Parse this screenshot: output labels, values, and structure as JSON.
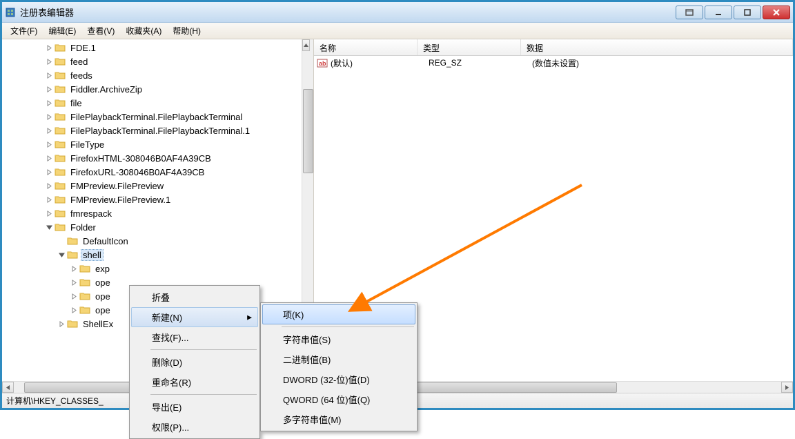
{
  "window": {
    "title": "注册表编辑器"
  },
  "menubar": {
    "items": [
      "文件(F)",
      "编辑(E)",
      "查看(V)",
      "收藏夹(A)",
      "帮助(H)"
    ]
  },
  "tree": {
    "items": [
      {
        "label": "FDE.1",
        "depth": 3,
        "expander": "closed",
        "expanded": false
      },
      {
        "label": "feed",
        "depth": 3,
        "expander": "closed",
        "expanded": false
      },
      {
        "label": "feeds",
        "depth": 3,
        "expander": "closed",
        "expanded": false
      },
      {
        "label": "Fiddler.ArchiveZip",
        "depth": 3,
        "expander": "closed",
        "expanded": false
      },
      {
        "label": "file",
        "depth": 3,
        "expander": "closed",
        "expanded": false
      },
      {
        "label": "FilePlaybackTerminal.FilePlaybackTerminal",
        "depth": 3,
        "expander": "closed",
        "expanded": false
      },
      {
        "label": "FilePlaybackTerminal.FilePlaybackTerminal.1",
        "depth": 3,
        "expander": "closed",
        "expanded": false
      },
      {
        "label": "FileType",
        "depth": 3,
        "expander": "closed",
        "expanded": false
      },
      {
        "label": "FirefoxHTML-308046B0AF4A39CB",
        "depth": 3,
        "expander": "closed",
        "expanded": false
      },
      {
        "label": "FirefoxURL-308046B0AF4A39CB",
        "depth": 3,
        "expander": "closed",
        "expanded": false
      },
      {
        "label": "FMPreview.FilePreview",
        "depth": 3,
        "expander": "closed",
        "expanded": false
      },
      {
        "label": "FMPreview.FilePreview.1",
        "depth": 3,
        "expander": "closed",
        "expanded": false
      },
      {
        "label": "fmrespack",
        "depth": 3,
        "expander": "closed",
        "expanded": false
      },
      {
        "label": "Folder",
        "depth": 3,
        "expander": "open",
        "expanded": true
      },
      {
        "label": "DefaultIcon",
        "depth": 4,
        "expander": "none",
        "expanded": false
      },
      {
        "label": "shell",
        "depth": 4,
        "expander": "open",
        "expanded": true,
        "selected": true
      },
      {
        "label": "exp",
        "depth": 5,
        "expander": "closed",
        "expanded": false
      },
      {
        "label": "ope",
        "depth": 5,
        "expander": "closed",
        "expanded": false
      },
      {
        "label": "ope",
        "depth": 5,
        "expander": "closed",
        "expanded": false
      },
      {
        "label": "ope",
        "depth": 5,
        "expander": "closed",
        "expanded": false
      },
      {
        "label": "ShellEx",
        "depth": 4,
        "expander": "closed",
        "expanded": false
      }
    ]
  },
  "list": {
    "columns": {
      "name": "名称",
      "type": "类型",
      "data": "数据"
    },
    "rows": [
      {
        "name": "(默认)",
        "type": "REG_SZ",
        "data": "(数值未设置)"
      }
    ]
  },
  "statusbar": {
    "path": "计算机\\HKEY_CLASSES_"
  },
  "context_menu_1": {
    "items": [
      {
        "label": "折叠",
        "type": "item"
      },
      {
        "label": "新建(N)",
        "type": "submenu",
        "hover": true
      },
      {
        "label": "查找(F)...",
        "type": "item"
      },
      {
        "type": "sep"
      },
      {
        "label": "删除(D)",
        "type": "item"
      },
      {
        "label": "重命名(R)",
        "type": "item"
      },
      {
        "type": "sep"
      },
      {
        "label": "导出(E)",
        "type": "item"
      },
      {
        "label": "权限(P)...",
        "type": "item"
      }
    ]
  },
  "context_menu_2": {
    "items": [
      {
        "label": "项(K)",
        "type": "item",
        "highlight": true
      },
      {
        "type": "sep"
      },
      {
        "label": "字符串值(S)",
        "type": "item"
      },
      {
        "label": "二进制值(B)",
        "type": "item"
      },
      {
        "label": "DWORD (32-位)值(D)",
        "type": "item"
      },
      {
        "label": "QWORD (64 位)值(Q)",
        "type": "item"
      },
      {
        "label": "多字符串值(M)",
        "type": "item"
      }
    ]
  }
}
